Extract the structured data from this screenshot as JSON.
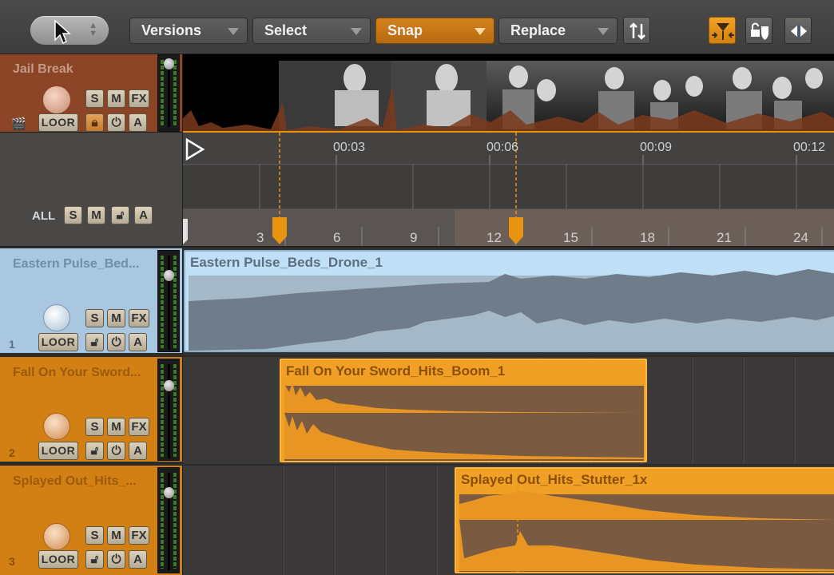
{
  "toolbar": {
    "versions_label": "Versions",
    "select_label": "Select",
    "snap_label": "Snap",
    "replace_label": "Replace"
  },
  "video_track": {
    "name": "Jail Break",
    "buttons": {
      "s": "S",
      "m": "M",
      "fx": "FX",
      "loop": "LOOR",
      "a": "A"
    }
  },
  "master": {
    "label": "ALL",
    "buttons": {
      "s": "S",
      "m": "M",
      "a": "A"
    }
  },
  "ruler": {
    "time_labels": [
      "00:03",
      "00:06",
      "00:09",
      "00:12"
    ],
    "beat_labels": [
      "3",
      "6",
      "9",
      "12",
      "15",
      "18",
      "21",
      "24"
    ]
  },
  "tracks": [
    {
      "number": "1",
      "name": "Eastern Pulse_Bed...",
      "region": "Eastern Pulse_Beds_Drone_1",
      "buttons": {
        "s": "S",
        "m": "M",
        "fx": "FX",
        "loop": "LOOR",
        "a": "A"
      }
    },
    {
      "number": "2",
      "name": "Fall On Your Sword...",
      "region": "Fall On Your Sword_Hits_Boom_1",
      "buttons": {
        "s": "S",
        "m": "M",
        "fx": "FX",
        "loop": "LOOR",
        "a": "A"
      }
    },
    {
      "number": "3",
      "name": "Splayed Out_Hits_...",
      "region": "Splayed Out_Hits_Stutter_1x",
      "buttons": {
        "s": "S",
        "m": "M",
        "fx": "FX",
        "loop": "LOOR",
        "a": "A"
      }
    }
  ],
  "colors": {
    "accent_orange": "#e89410",
    "track1_blue": "#a9c7e0",
    "video_track_red": "#8c4426"
  }
}
